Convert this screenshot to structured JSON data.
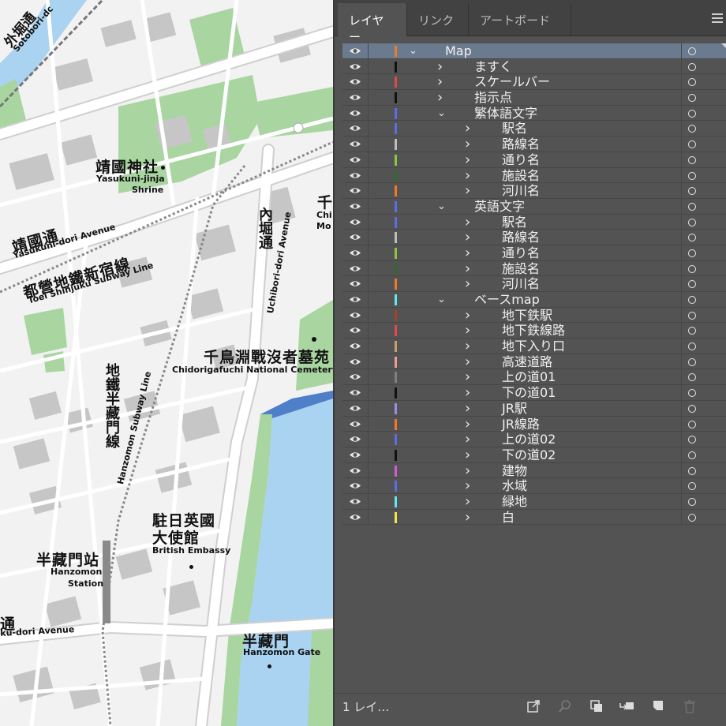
{
  "panel": {
    "tabs": [
      "レイヤー",
      "リンク",
      "アートボード"
    ],
    "active_tab": 0,
    "layers": [
      {
        "name": "Map",
        "depth": 0,
        "expanded": true,
        "color": "#f07a26",
        "selected": true
      },
      {
        "name": "ますく",
        "depth": 1,
        "expanded": false,
        "color": "#111111"
      },
      {
        "name": "スケールバー",
        "depth": 1,
        "expanded": false,
        "color": "#e24a4a"
      },
      {
        "name": "指示点",
        "depth": 1,
        "expanded": false,
        "color": "#111111"
      },
      {
        "name": "繁体語文字",
        "depth": 1,
        "expanded": true,
        "color": "#5a6ee6"
      },
      {
        "name": "駅名",
        "depth": 2,
        "expanded": false,
        "color": "#5a6ee6"
      },
      {
        "name": "路線名",
        "depth": 2,
        "expanded": false,
        "color": "#bdbdbd"
      },
      {
        "name": "通り名",
        "depth": 2,
        "expanded": false,
        "color": "#8ec63f"
      },
      {
        "name": "施設名",
        "depth": 2,
        "expanded": false,
        "color": "#2f6b2f"
      },
      {
        "name": "河川名",
        "depth": 2,
        "expanded": false,
        "color": "#f07a26"
      },
      {
        "name": "英語文字",
        "depth": 1,
        "expanded": true,
        "color": "#5a6ee6"
      },
      {
        "name": "駅名",
        "depth": 2,
        "expanded": false,
        "color": "#5a6ee6"
      },
      {
        "name": "路線名",
        "depth": 2,
        "expanded": false,
        "color": "#bdbdbd"
      },
      {
        "name": "通り名",
        "depth": 2,
        "expanded": false,
        "color": "#8ec63f"
      },
      {
        "name": "施設名",
        "depth": 2,
        "expanded": false,
        "color": "#2f6b2f"
      },
      {
        "name": "河川名",
        "depth": 2,
        "expanded": false,
        "color": "#f07a26"
      },
      {
        "name": "ベースmap",
        "depth": 1,
        "expanded": true,
        "color": "#66e6f0"
      },
      {
        "name": "地下鉄駅",
        "depth": 2,
        "expanded": false,
        "color": "#a0452a"
      },
      {
        "name": "地下鉄線路",
        "depth": 2,
        "expanded": false,
        "color": "#e24a4a"
      },
      {
        "name": "地下入り口",
        "depth": 2,
        "expanded": false,
        "color": "#c9a06a"
      },
      {
        "name": "高速道路",
        "depth": 2,
        "expanded": false,
        "color": "#f29a9a"
      },
      {
        "name": "上の道01",
        "depth": 2,
        "expanded": false,
        "color": "#808080"
      },
      {
        "name": "下の道01",
        "depth": 2,
        "expanded": false,
        "color": "#111111"
      },
      {
        "name": "JR駅",
        "depth": 2,
        "expanded": false,
        "color": "#9f8ce6"
      },
      {
        "name": "JR線路",
        "depth": 2,
        "expanded": false,
        "color": "#f07a26"
      },
      {
        "name": "上の道02",
        "depth": 2,
        "expanded": false,
        "color": "#5a6ee6"
      },
      {
        "name": "下の道02",
        "depth": 2,
        "expanded": false,
        "color": "#111111"
      },
      {
        "name": "建物",
        "depth": 2,
        "expanded": false,
        "color": "#d65ad6"
      },
      {
        "name": "水域",
        "depth": 2,
        "expanded": false,
        "color": "#5a6ee6"
      },
      {
        "name": "緑地",
        "depth": 2,
        "expanded": false,
        "color": "#66e6f0"
      },
      {
        "name": "白",
        "depth": 2,
        "expanded": false,
        "color": "#f2e64a"
      }
    ],
    "footer": {
      "layer_count": "1 レイ…",
      "buttons": [
        "export-icon",
        "search-icon",
        "clip-mask-icon",
        "move-to-layer-icon",
        "new-layer-icon",
        "trash-icon"
      ]
    }
  },
  "map": {
    "labels": {
      "yasukuni_jp": "靖國神社",
      "yasukuni_en1": "Yasukuni-jinja",
      "yasukuni_en2": "Shrine",
      "yasukuni_dori_jp": "靖國通",
      "yasukuni_dori_en": "Yasukuni-dori Avenue",
      "shinjuku_line_jp": "都營地鐵新宿線",
      "shinjuku_line_en": "Toei Shinjuku Subway Line",
      "uchibori_jp": "內堀通",
      "uchibori_en": "Uchibori-dori Avenue",
      "chidorigafuchi_jp": "千鳥淵戰沒者墓苑",
      "chidorigafuchi_en": "Chidorigafuchi National Cemetery",
      "chi_jp": "千",
      "chi_en1": "Chi",
      "chi_en2": "Mo",
      "hanzomon_line_jp": "地鐵半藏門線",
      "hanzomon_line_en": "Hanzomon Subway Line",
      "embassy_jp1": "駐日英國",
      "embassy_jp2": "大使館",
      "embassy_en": "British Embassy",
      "hanzomon_st_jp": "半藏門站",
      "hanzomon_st_en1": "Hanzomon",
      "hanzomon_st_en2": "Station",
      "hanzomon_gate_jp": "半藏門",
      "hanzomon_gate_en": "Hanzomon Gate",
      "shinjuku_dori_jp": "通",
      "shinjuku_dori_en": "ku-dori Avenue",
      "sotobori_jp": "外堀通",
      "sotobori_en": "Sotobori-dc"
    }
  }
}
